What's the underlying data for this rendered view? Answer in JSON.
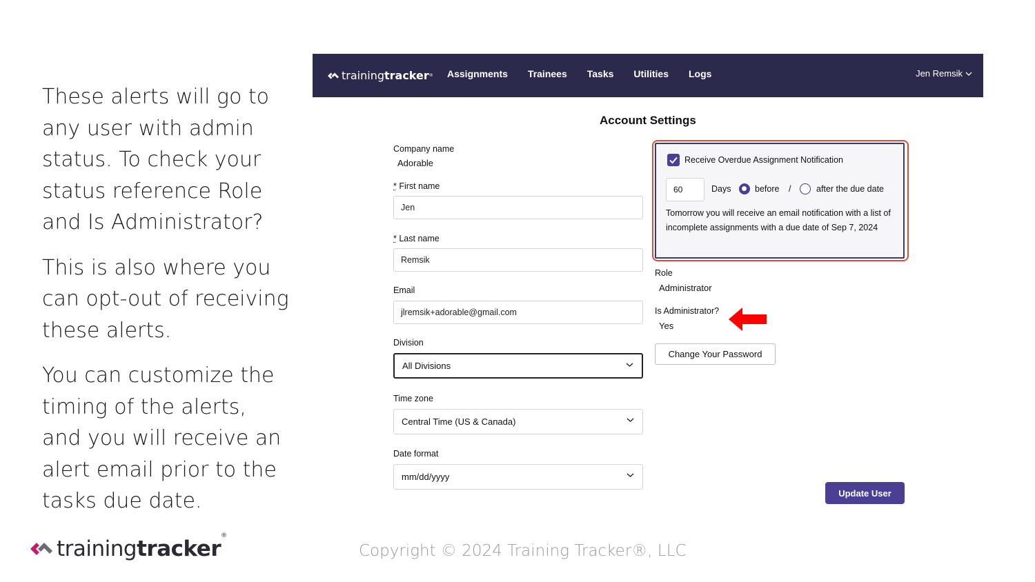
{
  "narrative": {
    "p1": "These alerts will go to any user with admin status. To check your status reference Role and Is Administrator?",
    "p2": "This is also where you can opt-out of receiving these alerts.",
    "p3": "You can customize the timing of the alerts, and you will receive an alert email prior to the tasks due date."
  },
  "brand": {
    "light": "training",
    "bold": "tracker",
    "reg": "®"
  },
  "copyright": "Copyright © 2024 Training Tracker®, LLC",
  "app": {
    "nav": {
      "logo_light": "training",
      "logo_bold": "tracker",
      "logo_reg": "®",
      "items": [
        "Assignments",
        "Trainees",
        "Tasks",
        "Utilities",
        "Logs"
      ],
      "user": "Jen Remsik"
    },
    "title": "Account Settings",
    "company": {
      "label": "Company name",
      "value": "Adorable"
    },
    "first_name": {
      "req": "*",
      "label": " First name",
      "value": "Jen"
    },
    "last_name": {
      "req": "*",
      "label": " Last name",
      "value": "Remsik"
    },
    "email": {
      "label": "Email",
      "value": "jlremsik+adorable@gmail.com"
    },
    "division": {
      "label": "Division",
      "value": "All Divisions"
    },
    "timezone": {
      "label": "Time zone",
      "value": "Central Time (US & Canada)"
    },
    "date_format": {
      "label": "Date format",
      "value": "mm/dd/yyyy"
    },
    "notification": {
      "checkbox_label": "Receive Overdue Assignment Notification",
      "checked": true,
      "days": "60",
      "days_label": "Days",
      "before_label": "before",
      "slash": "/",
      "after_label": "after  the due date",
      "message": "Tomorrow you will receive an email notification with a list of incomplete assignments with a due date of Sep 7, 2024"
    },
    "role": {
      "label": "Role",
      "value": "Administrator"
    },
    "is_admin": {
      "label": "Is Administrator?",
      "value": "Yes"
    },
    "change_password": "Change Your Password",
    "update_user": "Update User",
    "colors": {
      "navbar": "#2b2a4c",
      "accent": "#4a3f94",
      "highlight": "#e04a3a",
      "arrow": "#ff0000"
    }
  }
}
